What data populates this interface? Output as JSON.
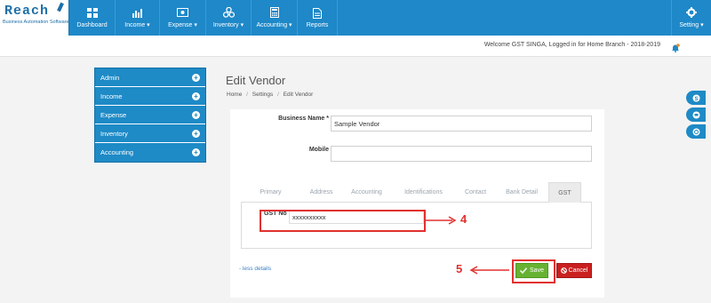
{
  "logo": {
    "brand": "Reach",
    "tagline": "Business Automation Software"
  },
  "nav": {
    "items": [
      {
        "label": "Dashboard",
        "icon": "dashboard-icon"
      },
      {
        "label": "Income ▾",
        "icon": "income-chart-icon"
      },
      {
        "label": "Expense ▾",
        "icon": "expense-cash-icon"
      },
      {
        "label": "Inventory ▾",
        "icon": "inventory-cubes-icon"
      },
      {
        "label": "Accounting ▾",
        "icon": "calculator-icon"
      },
      {
        "label": "Reports",
        "icon": "report-document-icon"
      }
    ],
    "setting_label": "Setting ▾"
  },
  "welcome": "Welcome GST SINGA, Logged in for Home Branch - 2018-2019",
  "sidebar": {
    "items": [
      {
        "label": "Admin"
      },
      {
        "label": "Income"
      },
      {
        "label": "Expense"
      },
      {
        "label": "Inventory"
      },
      {
        "label": "Accounting"
      }
    ]
  },
  "page": {
    "title": "Edit Vendor",
    "breadcrumb": [
      "Home",
      "/",
      "Settings",
      "/",
      "Edit Vendor"
    ]
  },
  "form": {
    "business_name_label": "Business Name",
    "required_marker": "*",
    "business_name_value": "Sample Vendor",
    "mobile_label": "Mobile",
    "mobile_value": "",
    "tabs": [
      "Primary",
      "Address",
      "Accounting",
      "Identifications",
      "Contact",
      "Bank Detail",
      "GST"
    ],
    "active_tab": "GST",
    "gst_label": "GST No",
    "gst_value": "xxxxxxxxxx",
    "less_details": "- less details",
    "save_label": "Save",
    "cancel_label": "Cancel"
  },
  "annotations": {
    "step_gst": "4",
    "step_save": "5"
  },
  "colors": {
    "nav": "#1e88c8",
    "save": "#67b233",
    "cancel": "#c9201f",
    "annotation": "#e0312f"
  }
}
